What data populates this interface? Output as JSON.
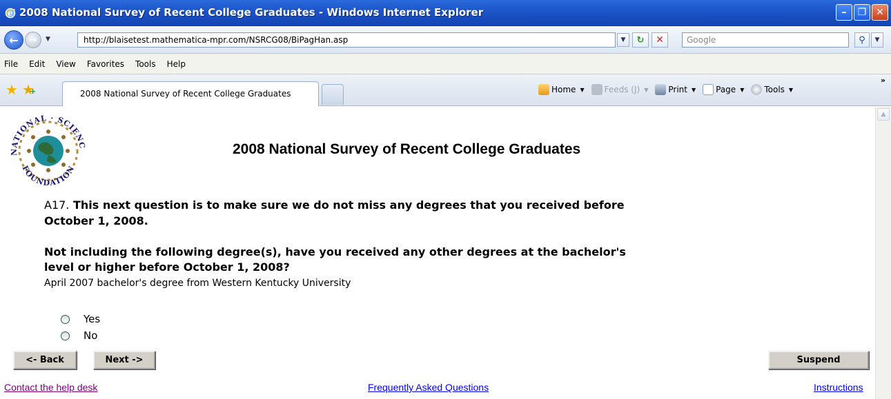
{
  "window": {
    "title": "2008 National Survey of Recent College Graduates - Windows Internet Explorer"
  },
  "addressbar": {
    "url": "http://blaisetest.mathematica-mpr.com/NSRCG08/BiPagHan.asp",
    "search_placeholder": "Google"
  },
  "menubar": {
    "items": [
      "File",
      "Edit",
      "View",
      "Favorites",
      "Tools",
      "Help"
    ]
  },
  "tabbar": {
    "tab_title": "2008 National Survey of Recent College Graduates",
    "commands": {
      "home": "Home",
      "feeds": "Feeds (J)",
      "print": "Print",
      "page": "Page",
      "tools": "Tools"
    }
  },
  "page": {
    "logo_text": "NATIONAL SCIENCE FOUNDATION",
    "heading": "2008 National Survey of Recent College Graduates",
    "question_number": "A17.",
    "question_line1": "This next question is to make sure we do not miss any degrees that you received before",
    "question_line2": "October 1, 2008.",
    "question_line3": "Not including the following degree(s), have you received any other degrees at the bachelor's",
    "question_line4": "level or higher before October 1, 2008?",
    "degree_info": "April 2007 bachelor's degree from Western Kentucky University",
    "options": [
      "Yes",
      "No"
    ],
    "buttons": {
      "back": "<- Back",
      "next": "Next ->",
      "suspend": "Suspend"
    },
    "links": {
      "help": "Contact the help desk",
      "faq": "Frequently Asked Questions",
      "instructions": "Instructions"
    }
  },
  "colors": {
    "titlebar": "#1b53c8",
    "visited_link": "#800080",
    "link": "#0000ee"
  }
}
